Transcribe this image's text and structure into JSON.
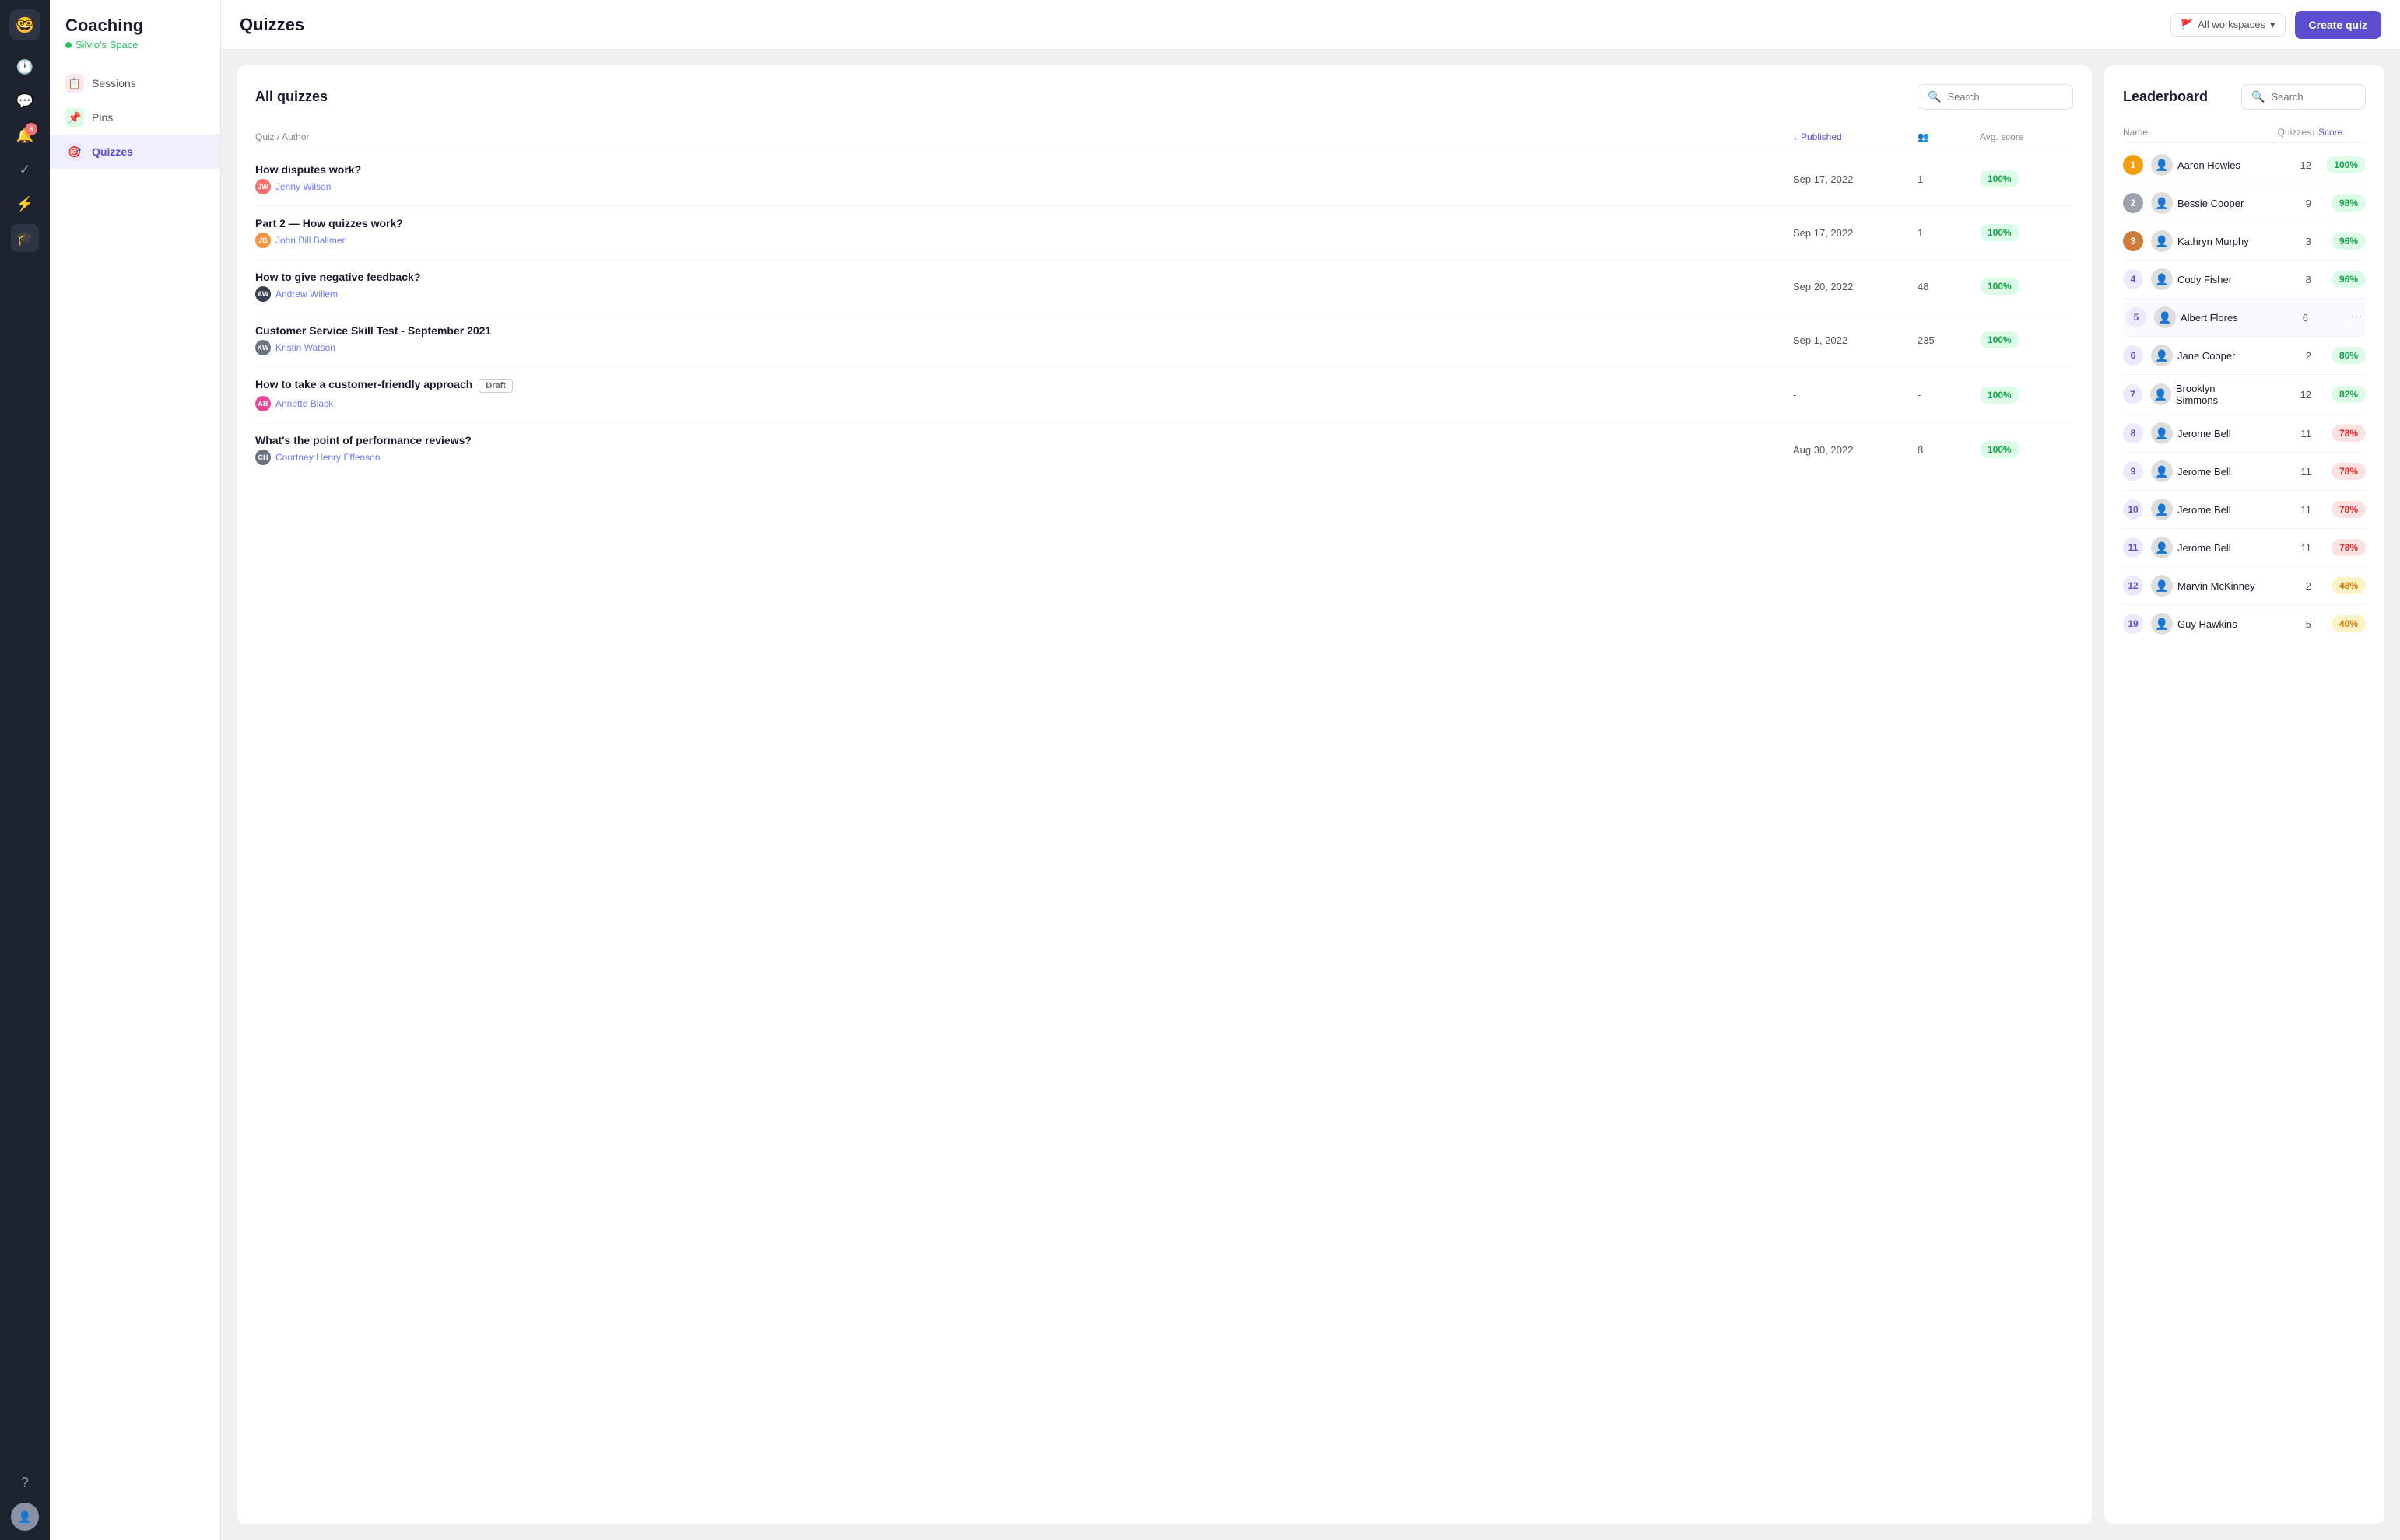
{
  "app": {
    "logo_emoji": "🤓",
    "title": "Coaching",
    "space": "Silvio's Space"
  },
  "rail": {
    "icons": [
      {
        "name": "clock-icon",
        "symbol": "🕐",
        "active": false
      },
      {
        "name": "chat-icon",
        "symbol": "💬",
        "active": false
      },
      {
        "name": "notification-icon",
        "symbol": "🔔",
        "active": false,
        "badge": "8"
      },
      {
        "name": "task-icon",
        "symbol": "✓",
        "active": false
      },
      {
        "name": "lightning-icon",
        "symbol": "⚡",
        "active": false
      },
      {
        "name": "cap-icon",
        "symbol": "🎓",
        "active": true
      }
    ]
  },
  "nav": {
    "items": [
      {
        "id": "sessions",
        "label": "Sessions",
        "icon": "📋",
        "active": false
      },
      {
        "id": "pins",
        "label": "Pins",
        "icon": "📌",
        "active": false
      },
      {
        "id": "quizzes",
        "label": "Quizzes",
        "icon": "🎯",
        "active": true
      }
    ]
  },
  "topbar": {
    "title": "Quizzes",
    "workspace_label": "All workspaces",
    "create_btn": "Create quiz"
  },
  "quiz_panel": {
    "title": "All quizzes",
    "search_placeholder": "Search",
    "columns": [
      {
        "label": "Quiz / Author"
      },
      {
        "label": "Published",
        "sorted": true
      },
      {
        "label": "",
        "icon": "👥"
      },
      {
        "label": "Avg. score"
      }
    ],
    "rows": [
      {
        "name": "How disputes work?",
        "author": "Jenny Wilson",
        "author_color": "#f87171",
        "author_initials": "JW",
        "date": "Sep 17, 2022",
        "count": "1",
        "score": "100%",
        "score_type": "green",
        "draft": false
      },
      {
        "name": "Part 2 — How quizzes work?",
        "author": "John Bill Ballmer",
        "author_color": "#fb923c",
        "author_initials": "JB",
        "date": "Sep 17, 2022",
        "count": "1",
        "score": "100%",
        "score_type": "green",
        "draft": false
      },
      {
        "name": "How to give negative feedback?",
        "author": "Andrew Willem",
        "author_color": "#374151",
        "author_initials": "AW",
        "date": "Sep 20, 2022",
        "count": "48",
        "score": "100%",
        "score_type": "green",
        "draft": false
      },
      {
        "name": "Customer Service Skill Test - September 2021",
        "author": "Kristin Watson",
        "author_color": "#6b7280",
        "author_initials": "KW",
        "date": "Sep 1, 2022",
        "count": "235",
        "score": "100%",
        "score_type": "green",
        "draft": false
      },
      {
        "name": "How to take a customer-friendly approach",
        "author": "Annette Black",
        "author_color": "#ec4899",
        "author_initials": "AB",
        "date": "-",
        "count": "-",
        "score": "100%",
        "score_type": "green",
        "draft": true
      },
      {
        "name": "What's the point of performance reviews?",
        "author": "Courtney Henry Effenson",
        "author_color": "#6b7280",
        "author_initials": "CH",
        "date": "Aug 30, 2022",
        "count": "8",
        "score": "100%",
        "score_type": "green",
        "draft": false
      }
    ]
  },
  "leaderboard": {
    "title": "Leaderboard",
    "search_placeholder": "Search",
    "col_name": "Name",
    "col_quizzes": "Quizzes",
    "col_score": "Score",
    "rows": [
      {
        "rank": "1",
        "rank_type": "gold",
        "name": "Aaron Howles",
        "quizzes": "12",
        "score": "100%",
        "score_type": "green",
        "highlighted": false
      },
      {
        "rank": "2",
        "rank_type": "silver",
        "name": "Bessie Cooper",
        "quizzes": "9",
        "score": "98%",
        "score_type": "green",
        "highlighted": false
      },
      {
        "rank": "3",
        "rank_type": "bronze",
        "name": "Kathryn Murphy",
        "quizzes": "3",
        "score": "96%",
        "score_type": "green",
        "highlighted": false
      },
      {
        "rank": "4",
        "rank_type": "other",
        "name": "Cody Fisher",
        "quizzes": "8",
        "score": "96%",
        "score_type": "green",
        "highlighted": false
      },
      {
        "rank": "5",
        "rank_type": "other",
        "name": "Albert Flores",
        "quizzes": "6",
        "score": "",
        "score_type": "more",
        "highlighted": true
      },
      {
        "rank": "6",
        "rank_type": "other",
        "name": "Jane Cooper",
        "quizzes": "2",
        "score": "86%",
        "score_type": "green",
        "highlighted": false
      },
      {
        "rank": "7",
        "rank_type": "other",
        "name": "Brooklyn Simmons",
        "quizzes": "12",
        "score": "82%",
        "score_type": "green",
        "highlighted": false
      },
      {
        "rank": "8",
        "rank_type": "other",
        "name": "Jerome Bell",
        "quizzes": "11",
        "score": "78%",
        "score_type": "red",
        "highlighted": false
      },
      {
        "rank": "9",
        "rank_type": "other",
        "name": "Jerome Bell",
        "quizzes": "11",
        "score": "78%",
        "score_type": "red",
        "highlighted": false
      },
      {
        "rank": "10",
        "rank_type": "other",
        "name": "Jerome Bell",
        "quizzes": "11",
        "score": "78%",
        "score_type": "red",
        "highlighted": false
      },
      {
        "rank": "11",
        "rank_type": "other",
        "name": "Jerome Bell",
        "quizzes": "11",
        "score": "78%",
        "score_type": "red",
        "highlighted": false
      },
      {
        "rank": "12",
        "rank_type": "other",
        "name": "Marvin McKinney",
        "quizzes": "2",
        "score": "48%",
        "score_type": "orange",
        "highlighted": false
      },
      {
        "rank": "19",
        "rank_type": "other",
        "name": "Guy Hawkins",
        "quizzes": "5",
        "score": "40%",
        "score_type": "orange",
        "highlighted": false
      }
    ]
  }
}
